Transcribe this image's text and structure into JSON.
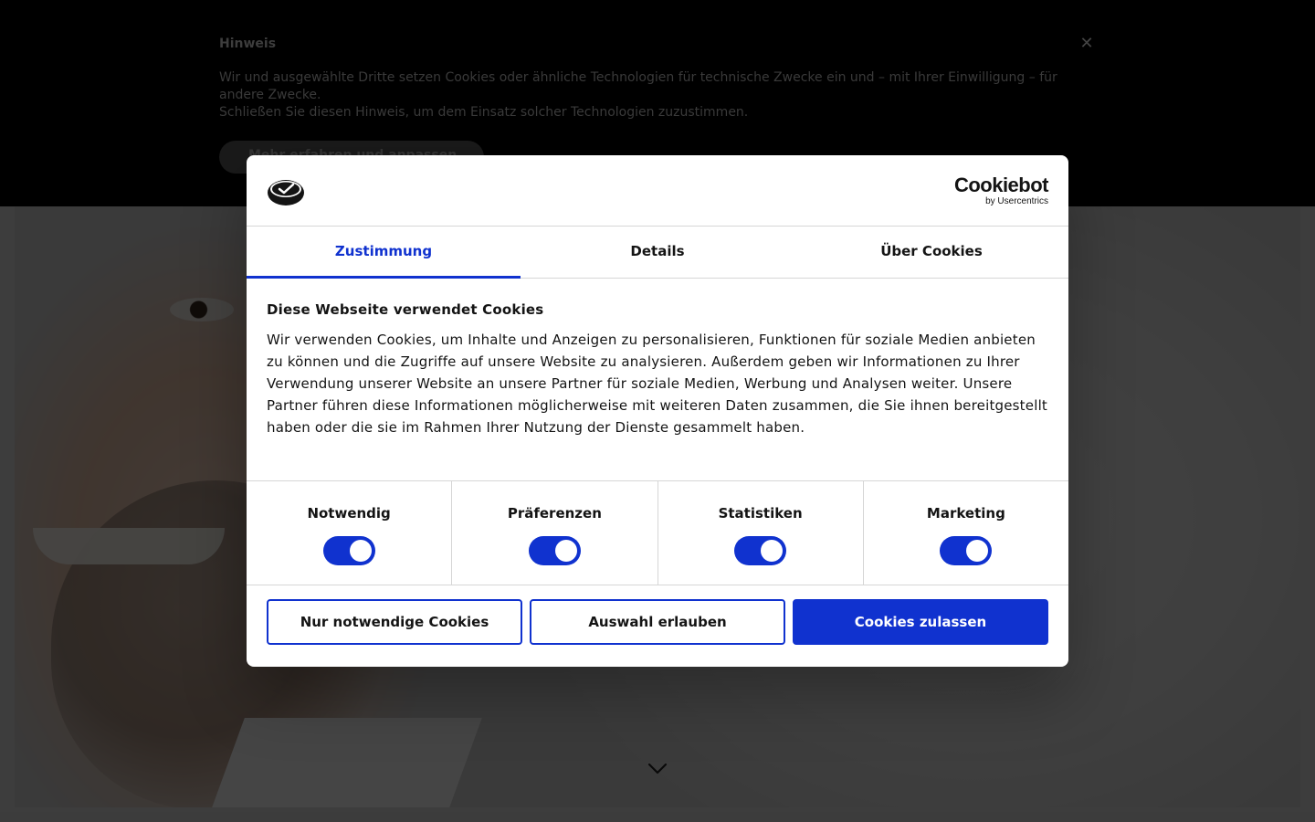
{
  "notice": {
    "title": "Hinweis",
    "close_icon": "close-icon",
    "text_line1": "Wir und ausgewählte Dritte setzen Cookies oder ähnliche Technologien für technische Zwecke ein und – mit Ihrer Einwilligung – für andere Zwecke.",
    "text_line2": "Schließen Sie diesen Hinweis, um dem Einsatz solcher Technologien zuzustimmen.",
    "button_label": "Mehr erfahren und anpassen"
  },
  "dialog": {
    "brand_logo_icon": "brand-logo-icon",
    "cookiebot_name": "Cookiebot",
    "cookiebot_by": "by Usercentrics",
    "tabs": [
      {
        "label": "Zustimmung",
        "active": true
      },
      {
        "label": "Details",
        "active": false
      },
      {
        "label": "Über Cookies",
        "active": false
      }
    ],
    "title": "Diese Webseite verwendet Cookies",
    "body": "Wir verwenden Cookies, um Inhalte und Anzeigen zu personalisieren, Funktionen für soziale Medien anbieten zu können und die Zugriffe auf unsere Website zu analysieren. Außerdem geben wir Informationen zu Ihrer Verwendung unserer Website an unsere Partner für soziale Medien, Werbung und Analysen weiter. Unsere Partner führen diese Informationen möglicherweise mit weiteren Daten zusammen, die Sie ihnen bereitgestellt haben oder die sie im Rahmen Ihrer Nutzung der Dienste gesammelt haben.",
    "categories": [
      {
        "label": "Notwendig",
        "enabled": true
      },
      {
        "label": "Präferenzen",
        "enabled": true
      },
      {
        "label": "Statistiken",
        "enabled": true
      },
      {
        "label": "Marketing",
        "enabled": true
      }
    ],
    "buttons": {
      "necessary_only": "Nur notwendige Cookies",
      "allow_selection": "Auswahl erlauben",
      "allow_all": "Cookies zulassen"
    }
  },
  "colors": {
    "accent": "#1032cf",
    "overlay": "rgba(0,0,0,0.72)"
  },
  "page": {
    "scroll_icon": "chevron-down-icon"
  }
}
